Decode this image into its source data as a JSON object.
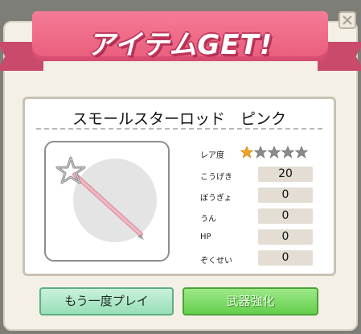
{
  "banner": {
    "title": "アイテムGET!"
  },
  "item": {
    "name": "スモールスターロッド　ピンク",
    "image_icon": "pink-star-rod-icon",
    "rarity_label": "レア度",
    "rarity": {
      "filled": 1,
      "total": 5
    }
  },
  "stats": [
    {
      "label": "こうげき",
      "value": "20"
    },
    {
      "label": "ぼうぎょ",
      "value": "0"
    },
    {
      "label": "うん",
      "value": "0"
    },
    {
      "label": "HP",
      "value": "0"
    },
    {
      "label": "ぞくせい",
      "value": "0"
    }
  ],
  "buttons": {
    "replay": "もう一度プレイ",
    "upgrade": "武器強化"
  },
  "colors": {
    "ribbon": "#ec6583",
    "star_filled": "#f2a11f",
    "star_empty": "#8a8a8a",
    "replay_button": "#a8e6c4",
    "upgrade_button": "#7ddc64"
  }
}
